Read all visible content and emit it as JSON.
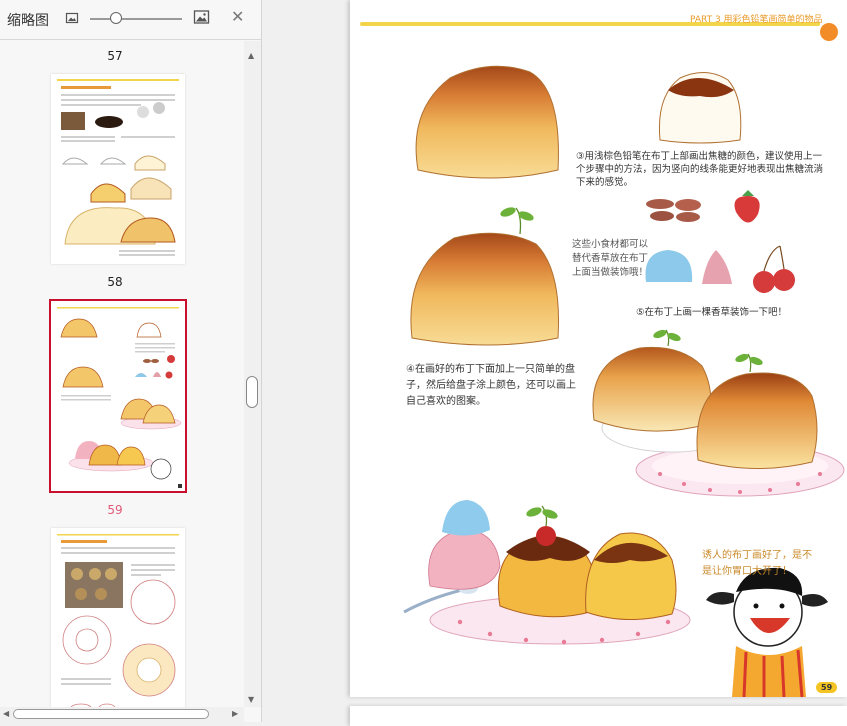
{
  "panel": {
    "title": "缩略图",
    "pages": [
      {
        "num": "57"
      },
      {
        "num": "58"
      },
      {
        "num": "59",
        "selected": true
      }
    ]
  },
  "doc": {
    "header": "PART 3 用彩色铅笔画简单的物品",
    "step3": "③用浅棕色铅笔在布丁上部画出焦糖的颜色，建议使用上一个步骤中的方法，因为竖向的线条能更好地表现出焦糖流淌下来的感觉。",
    "food_note": "这些小食材都可以替代香草放在布丁上面当做装饰哦！",
    "step5": "⑤在布丁上画一棵香草装饰一下吧！",
    "step4": "④在画好的布丁下面加上一只简单的盘子，然后给盘子涂上颜色，还可以画上自己喜欢的图案。",
    "caption": "诱人的布丁画好了，是不是让你胃口大开了！",
    "page_badge": "59"
  },
  "colors": {
    "caramel": "#b4581e",
    "pudding": "#f3c66a",
    "accent": "#f2d54a",
    "selection": "#c8102e"
  }
}
